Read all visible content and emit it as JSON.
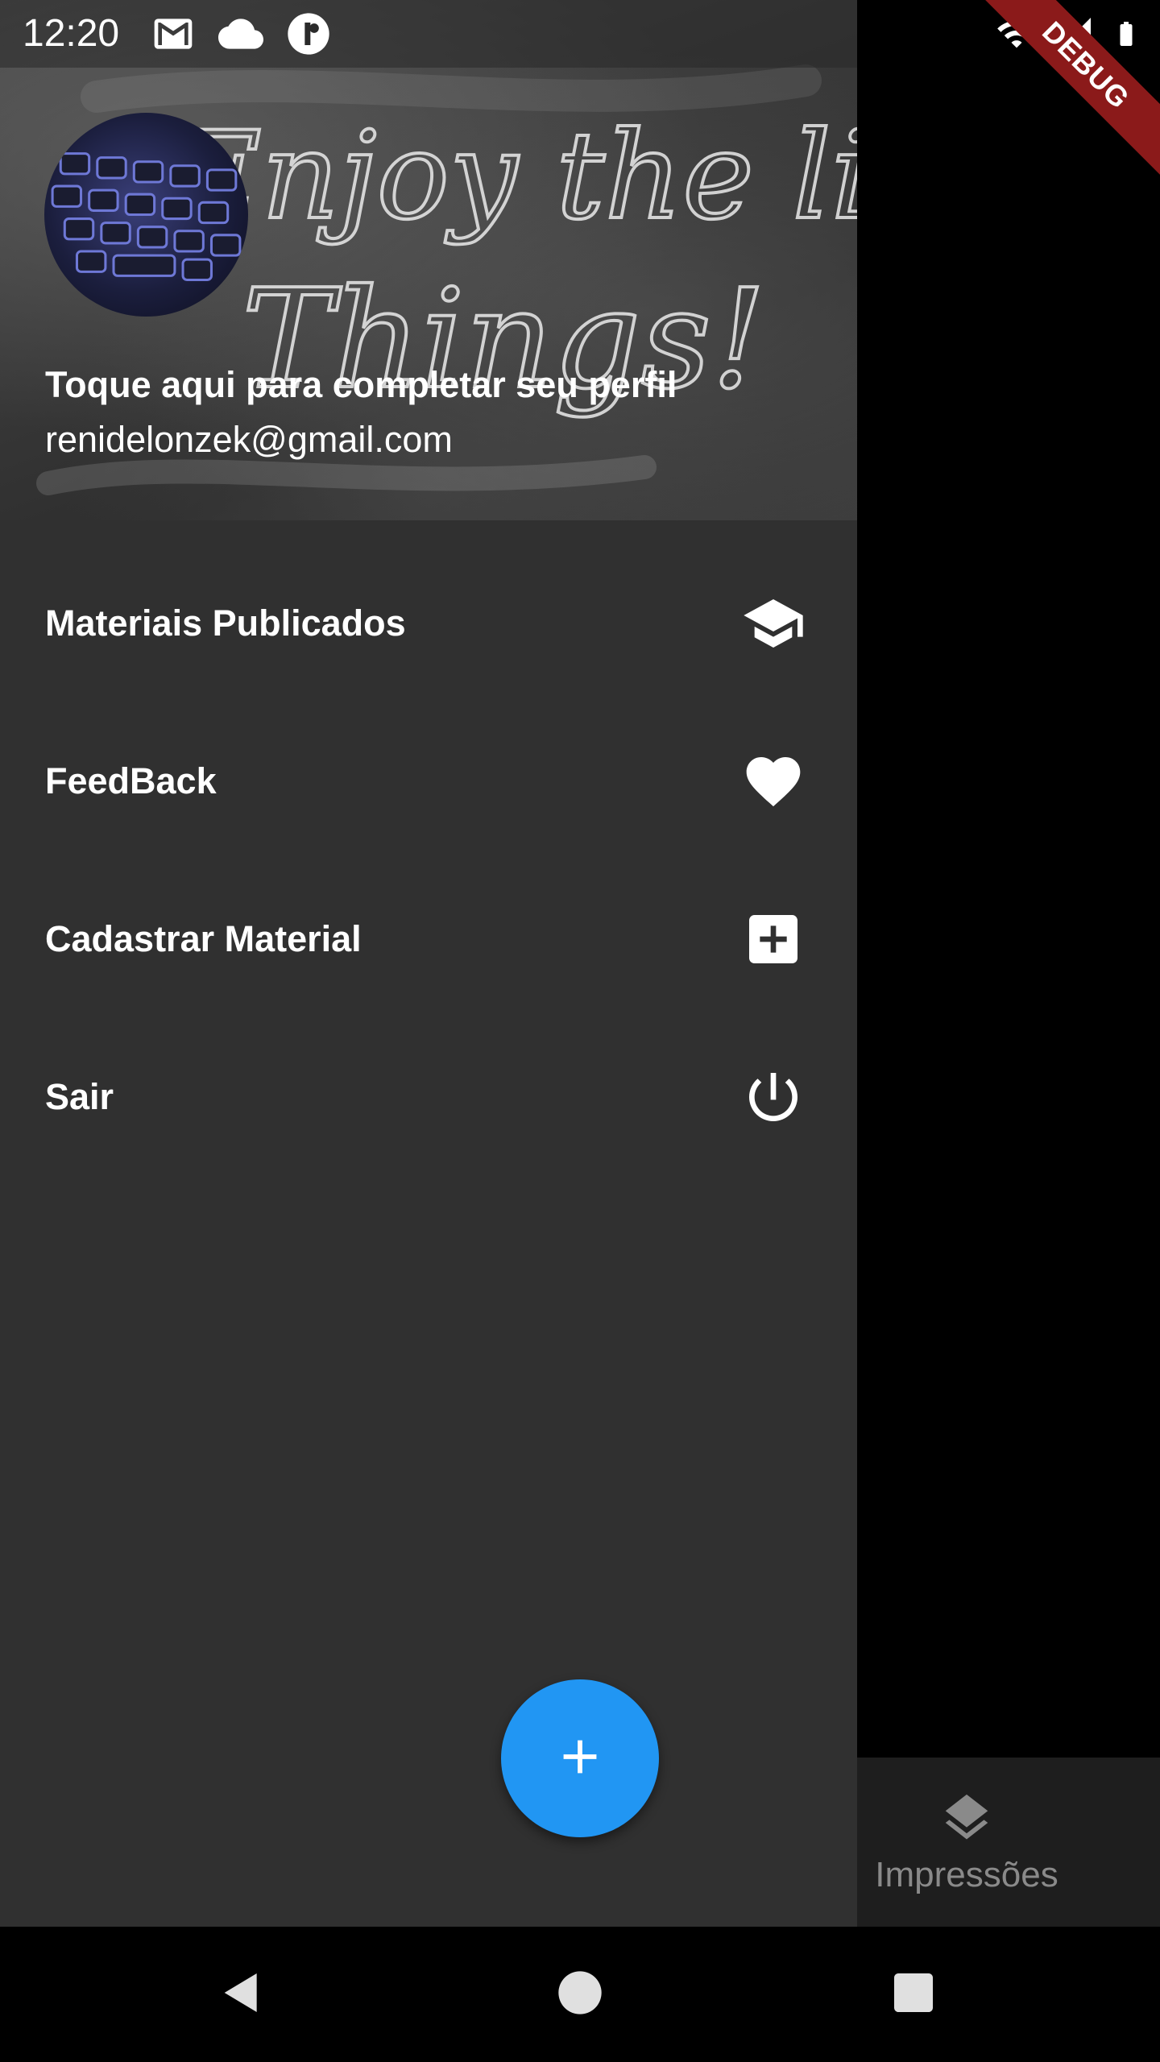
{
  "status_bar": {
    "time": "12:20",
    "left_icons": [
      "gmail-icon",
      "cloud-icon",
      "app-notification-icon"
    ],
    "right_icons": [
      "wifi-icon",
      "signal-icon",
      "battery-icon"
    ]
  },
  "debug_banner": {
    "label": "DEBUG",
    "color": "#8b1a1a"
  },
  "drawer": {
    "header": {
      "title": "Toque aqui para completar seu perfil",
      "email": "renidelonzek@gmail.com",
      "background_text_line1": "Enjoy the little",
      "background_text_line2": "Things!"
    },
    "items": [
      {
        "label": "Materiais Publicados",
        "icon": "school-icon"
      },
      {
        "label": "FeedBack",
        "icon": "heart-icon"
      },
      {
        "label": "Cadastrar Material",
        "icon": "add-box-icon"
      },
      {
        "label": "Sair",
        "icon": "power-icon"
      }
    ]
  },
  "fab": {
    "icon": "plus-icon",
    "color": "#2196f3"
  },
  "bottom_nav": {
    "items": [
      {
        "label": "Impressões",
        "icon": "layers-icon"
      }
    ]
  },
  "system_nav": [
    "back-icon",
    "home-icon",
    "recents-icon"
  ],
  "colors": {
    "drawer_bg": "#303030",
    "bottom_nav_bg": "#1e1e1e",
    "text_primary": "#ffffff",
    "text_inactive": "#8a8a8a"
  }
}
